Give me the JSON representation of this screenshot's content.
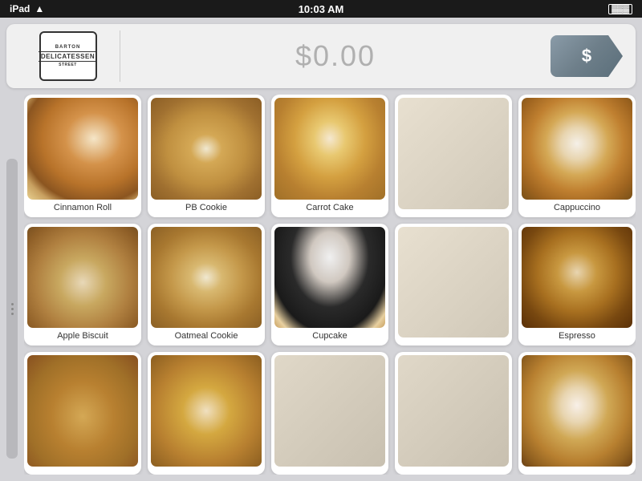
{
  "statusBar": {
    "left": "iPad",
    "center": "10:03 AM",
    "wifi": "wifi",
    "battery": "battery"
  },
  "toolbar": {
    "logo": {
      "line1": "BARTON",
      "line2": "DELICATESSEN",
      "line3": "STREET"
    },
    "price": "$0.00",
    "checkoutLabel": "$"
  },
  "products": [
    {
      "id": "cinnamon-roll",
      "label": "Cinnamon Roll",
      "foodClass": "food-cinnamon-roll"
    },
    {
      "id": "pb-cookie",
      "label": "PB Cookie",
      "foodClass": "food-pb-cookie"
    },
    {
      "id": "carrot-cake",
      "label": "Carrot Cake",
      "foodClass": "food-carrot-cake"
    },
    {
      "id": "empty-1",
      "label": "",
      "foodClass": "food-empty1"
    },
    {
      "id": "cappuccino",
      "label": "Cappuccino",
      "foodClass": "food-cappuccino"
    },
    {
      "id": "apple-biscuit",
      "label": "Apple Biscuit",
      "foodClass": "food-apple-biscuit"
    },
    {
      "id": "oatmeal-cookie",
      "label": "Oatmeal Cookie",
      "foodClass": "food-oatmeal-cookie"
    },
    {
      "id": "cupcake",
      "label": "Cupcake",
      "foodClass": "food-cupcake"
    },
    {
      "id": "empty-2",
      "label": "",
      "foodClass": "food-empty2"
    },
    {
      "id": "espresso",
      "label": "Espresso",
      "foodClass": "food-espresso"
    },
    {
      "id": "pastry",
      "label": "",
      "foodClass": "food-pastry"
    },
    {
      "id": "cookies2",
      "label": "",
      "foodClass": "food-cookies2"
    },
    {
      "id": "empty-3",
      "label": "",
      "foodClass": "food-empty3"
    },
    {
      "id": "empty-4",
      "label": "",
      "foodClass": "food-empty4"
    },
    {
      "id": "latte",
      "label": "",
      "foodClass": "food-latte"
    }
  ]
}
